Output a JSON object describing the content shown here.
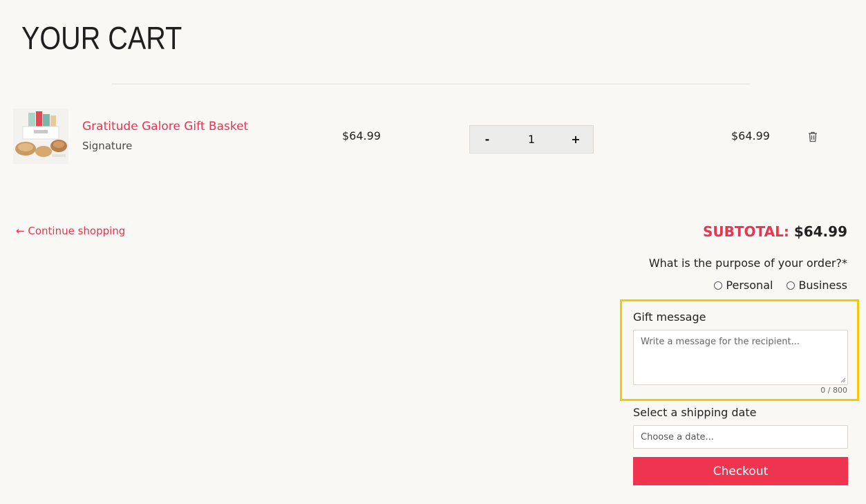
{
  "page": {
    "title": "YOUR CART"
  },
  "cart": {
    "items": [
      {
        "name": "Gratitude Galore Gift Basket",
        "variant": "Signature",
        "unit_price": "$64.99",
        "quantity": "1",
        "line_total": "$64.99",
        "decrement_label": "-",
        "increment_label": "+"
      }
    ]
  },
  "continue_shopping": {
    "arrow": "←",
    "label": "Continue shopping"
  },
  "subtotal": {
    "label": "SUBTOTAL:",
    "amount": "$64.99"
  },
  "purpose": {
    "question": "What is the purpose of your order?*",
    "options": [
      "Personal",
      "Business"
    ]
  },
  "gift_message": {
    "label": "Gift message",
    "placeholder": "Write a message for the recipient...",
    "counter": "0 / 800"
  },
  "shipping": {
    "label": "Select a shipping date",
    "placeholder": "Choose a date..."
  },
  "checkout": {
    "label": "Checkout"
  },
  "colors": {
    "accent": "#ea3450",
    "highlight": "#f5c800",
    "background": "#faf8f4"
  },
  "icons": {
    "delete": "trash-icon",
    "back": "arrow-left-icon",
    "product": "gift-basket-image"
  }
}
